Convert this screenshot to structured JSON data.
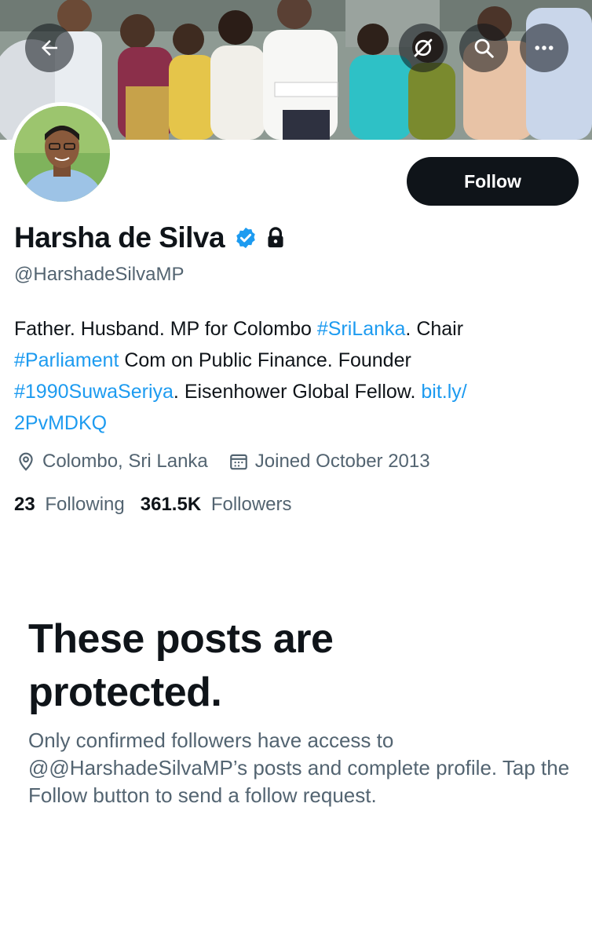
{
  "header": {
    "icons": {
      "back": "arrow-left-icon",
      "hide": "eye-slash-icon",
      "search": "search-icon",
      "more": "more-horizontal-icon"
    }
  },
  "profile": {
    "name": "Harsha de Silva",
    "handle": "@HarshadeSilvaMP",
    "follow_label": "Follow",
    "verified_icon": "verified-badge-icon",
    "protected_icon": "lock-icon",
    "bio": {
      "part1": "Father. Husband. MP for Colombo ",
      "tag1": "#SriLanka",
      "part2": ". Chair ",
      "tag2": "#Parliament",
      "part3": " Com on Public Finance. Founder ",
      "tag3": "#1990SuwaSeriya",
      "part4": ". Eisenhower Global Fellow. ",
      "link": "bit.ly/\n2PvMDKQ"
    },
    "location": "Colombo, Sri Lanka",
    "joined": "Joined October 2013",
    "following_count": "23",
    "following_label": "Following",
    "followers_count": "361.5K",
    "followers_label": "Followers"
  },
  "protected": {
    "title": "These posts are protected.",
    "message": "Only confirmed followers have access to @@HarshadeSilvaMP’s posts and complete profile. Tap the Follow button to send a follow request."
  },
  "colors": {
    "accent": "#1d9bf0",
    "text": "#0f1419",
    "secondary": "#536471"
  }
}
